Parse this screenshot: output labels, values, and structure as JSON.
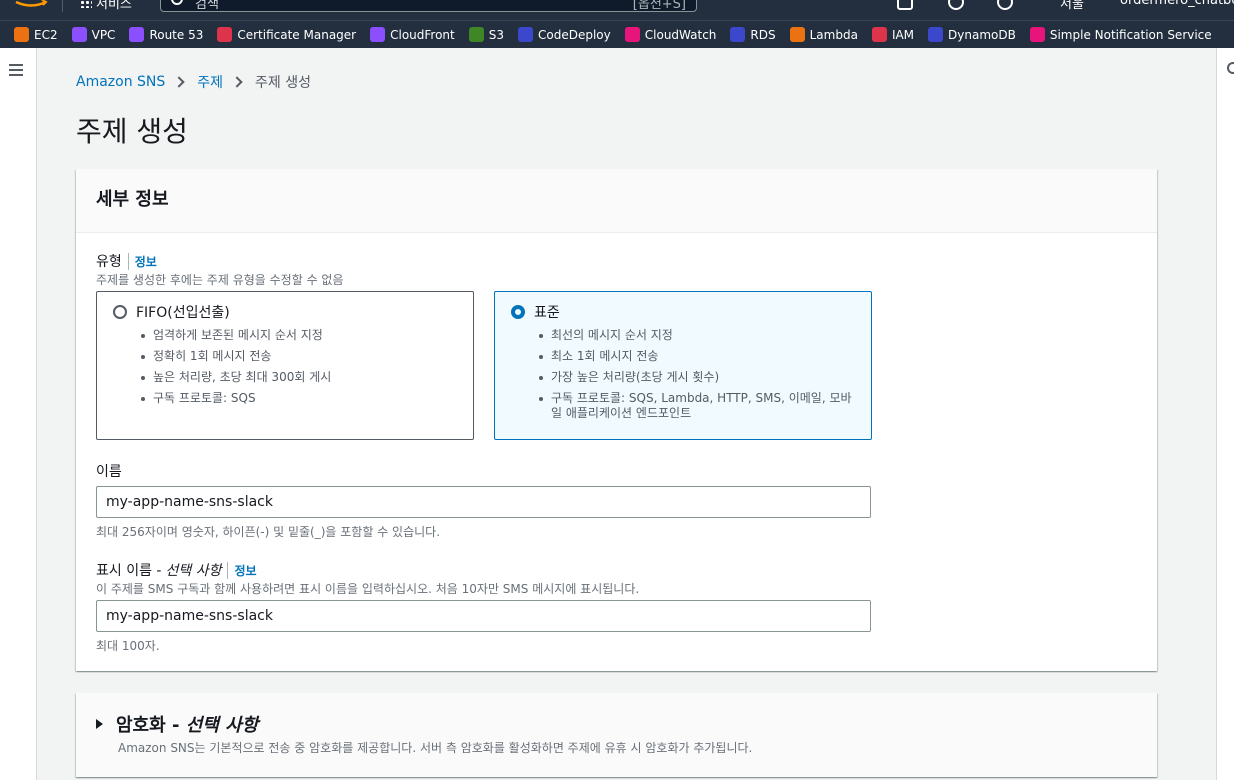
{
  "topnav": {
    "services_label": "서비스",
    "search_placeholder": "검색",
    "search_shortcut": "[옵션+S]",
    "region_label": "서울",
    "account_label": "ordermero_chatbot"
  },
  "favorites": [
    {
      "label": "EC2",
      "color": "#ec7211"
    },
    {
      "label": "VPC",
      "color": "#8c4fff"
    },
    {
      "label": "Route 53",
      "color": "#8c4fff"
    },
    {
      "label": "Certificate Manager",
      "color": "#dd344c"
    },
    {
      "label": "CloudFront",
      "color": "#8c4fff"
    },
    {
      "label": "S3",
      "color": "#3f8624"
    },
    {
      "label": "CodeDeploy",
      "color": "#3b48cc"
    },
    {
      "label": "CloudWatch",
      "color": "#e7157b"
    },
    {
      "label": "RDS",
      "color": "#3b48cc"
    },
    {
      "label": "Lambda",
      "color": "#ec7211"
    },
    {
      "label": "IAM",
      "color": "#dd344c"
    },
    {
      "label": "DynamoDB",
      "color": "#3b48cc"
    },
    {
      "label": "Simple Notification Service",
      "color": "#e7157b"
    }
  ],
  "breadcrumb": {
    "item1": "Amazon SNS",
    "item2": "주제",
    "current": "주제 생성"
  },
  "page_title": "주제 생성",
  "details": {
    "title": "세부 정보",
    "type_label": "유형",
    "info_label": "정보",
    "type_desc": "주제를 생성한 후에는 주제 유형을 수정할 수 없음",
    "fifo": {
      "title": "FIFO(선입선출)",
      "bullets": [
        "엄격하게 보존된 메시지 순서 지정",
        "정확히 1회 메시지 전송",
        "높은 처리량, 초당 최대 300회 게시",
        "구독 프로토콜: SQS"
      ]
    },
    "standard": {
      "title": "표준",
      "bullets": [
        "최선의 메시지 순서 지정",
        "최소 1회 메시지 전송",
        "가장 높은 처리량(초당 게시 횟수)",
        "구독 프로토콜: SQS, Lambda, HTTP, SMS, 이메일, 모바일 애플리케이션 엔드포인트"
      ]
    },
    "name_label": "이름",
    "name_value": "my-app-name-sns-slack",
    "name_hint": "최대 256자이며 영숫자, 하이픈(-) 및 밑줄(_)을 포함할 수 있습니다.",
    "display_label": "표시 이름 -",
    "display_optional": "선택 사항",
    "display_desc": "이 주제를 SMS 구독과 함께 사용하려면 표시 이름을 입력하십시오. 처음 10자만 SMS 메시지에 표시됩니다.",
    "display_value": "my-app-name-sns-slack",
    "display_hint": "최대 100자."
  },
  "encryption": {
    "title": "암호화 -",
    "optional": "선택 사항",
    "desc": "Amazon SNS는 기본적으로 전송 중 암호화를 제공합니다. 서버 측 암호화를 활성화하면 주제에 유휴 시 암호화가 추가됩니다."
  }
}
